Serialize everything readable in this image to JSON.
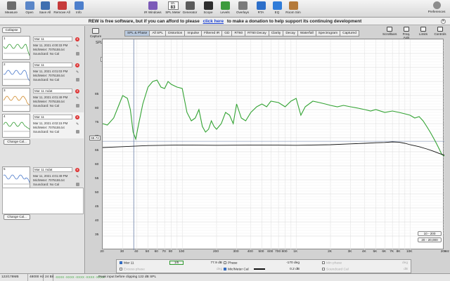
{
  "toolbar": {
    "buttons": [
      {
        "label": "Measure",
        "icon": "microphone-icon",
        "color": "#6c6c6c"
      },
      {
        "label": "Open",
        "icon": "folder-open-icon",
        "color": "#5a86c8"
      },
      {
        "label": "Save All",
        "icon": "save-icon",
        "color": "#3f6fb0"
      },
      {
        "label": "Remove All",
        "icon": "remove-all-icon",
        "color": "#c63a3a"
      },
      {
        "label": "Info",
        "icon": "info-icon",
        "color": "#4d7fcc"
      },
      {
        "label": "IR Windows",
        "icon": "ir-windows-icon",
        "color": "#7c5ab8"
      },
      {
        "label": "SPL Meter",
        "icon": "spl-meter-icon",
        "color": "#ffffff"
      },
      {
        "label": "Generator",
        "icon": "generator-icon",
        "color": "#5b5b5b"
      },
      {
        "label": "Scope",
        "icon": "scope-icon",
        "color": "#2e2e2e"
      },
      {
        "label": "Levels",
        "icon": "levels-icon",
        "color": "#3c9a3c"
      },
      {
        "label": "Overlays",
        "icon": "overlays-icon",
        "color": "#7a7a7a"
      },
      {
        "label": "RTA",
        "icon": "rta-icon",
        "color": "#2d6fc9"
      },
      {
        "label": "EQ",
        "icon": "eq-icon",
        "color": "#2f7cd9"
      },
      {
        "label": "Room Sim",
        "icon": "room-sim-icon",
        "color": "#b47a3a"
      }
    ],
    "spl_meter": {
      "unit": "SPL",
      "value": "83",
      "weight": "dB Z"
    },
    "preferences": "Preferences"
  },
  "banner": {
    "text_before": "REW is free software, but if you can afford to please",
    "link": "click here",
    "text_after": "to make a donation to help support its continuing development"
  },
  "panel": {
    "collapse": "Collapse",
    "measurements": [
      {
        "num": "1",
        "name": "Mar 11",
        "info": [
          "Mar 11, 2021 4:00:33 PM",
          "Mic/Meter: 7075155.txt",
          "Soundcard: No Cal"
        ],
        "color": "#2f9a2f"
      },
      {
        "num": "2",
        "name": "Mar 11",
        "info": [
          "Mar 11, 2021 4:01:03 PM",
          "Mic/Meter: 7075155.txt",
          "Soundcard: No Cal"
        ],
        "color": "#4a78c9"
      },
      {
        "num": "3",
        "name": "Mar 11 mdat",
        "info": [
          "Mar 11, 2021 4:01:49 PM",
          "Mic/Meter: 7075155.txt",
          "Soundcard: No Cal"
        ],
        "color": "#d08a2a"
      },
      {
        "num": "4",
        "name": "Mar 11",
        "info": [
          "Mar 11, 2021 4:02:15 PM",
          "Mic/Meter: 7075155.txt",
          "Soundcard: No Cal"
        ],
        "color": "#2f9a2f"
      },
      {
        "num": "5",
        "name": "Mar 11 mdat",
        "info": [
          "Mar 11, 2021 4:01:49 PM",
          "Mic/Meter: 7075155.txt",
          "Soundcard: No Cal"
        ],
        "color": "#4a78c9"
      }
    ],
    "change_cal": "Change Cal..."
  },
  "main": {
    "capture": "Capture",
    "tabs": [
      "SPL & Phase",
      "All SPL",
      "Distortion",
      "Impulse",
      "Filtered IR",
      "GD",
      "RT60",
      "RT60 Decay",
      "Clarity",
      "Decay",
      "Waterfall",
      "Spectrogram",
      "Captured"
    ],
    "tools": [
      "Scrollbars",
      "Freq. Axis",
      "Limits",
      "Controls"
    ],
    "y_unit": "SPL",
    "plot_select": "SPL",
    "cursor_value": "68.72",
    "y_ticks": [
      "85",
      "80",
      "75",
      "70",
      "65",
      "60",
      "55",
      "50",
      "45",
      "40",
      "35"
    ],
    "x_ticks": [
      "20",
      "30",
      "40",
      "50",
      "60",
      "70",
      "80",
      "100",
      "200",
      "300",
      "400",
      "500",
      "600",
      "700",
      "800",
      "1K",
      "2K",
      "3K",
      "4K",
      "5K",
      "6K",
      "7K",
      "8K",
      "10K",
      "20K"
    ],
    "x_unit": "Hz",
    "cursor_freq": "37.5",
    "zoom_buttons": [
      "10 - 200",
      "20 - 20,000"
    ]
  },
  "legend": {
    "series": [
      {
        "checked": true,
        "label": "Mar 11",
        "value": "77.9 dB",
        "color": "#2f9a2f"
      },
      {
        "checked": false,
        "label": "Phase",
        "value": "-170 deg",
        "color": "#888888"
      },
      {
        "checked": false,
        "label": "Min phase",
        "value": "deg",
        "color": "#aaaaaa"
      },
      {
        "checked": false,
        "label": "Excess phase",
        "value": "deg",
        "color": "#aaaaaa"
      },
      {
        "checked": true,
        "label": "Mic/Meter Cal",
        "value": "0.2 dB",
        "color": "#111111"
      },
      {
        "checked": false,
        "label": "Soundcard Cal",
        "value": "dB",
        "color": "#aaaaaa"
      }
    ],
    "toggle_label": "1/6"
  },
  "status": {
    "memory": "122/178MB",
    "sample_rate": "48000 Hz",
    "bits": "24 Bit",
    "level_scale": "-XXXX -XXXX -XXXX -XXXX -XXXX",
    "message": "Peak input before clipping 122 dB SPL"
  }
}
